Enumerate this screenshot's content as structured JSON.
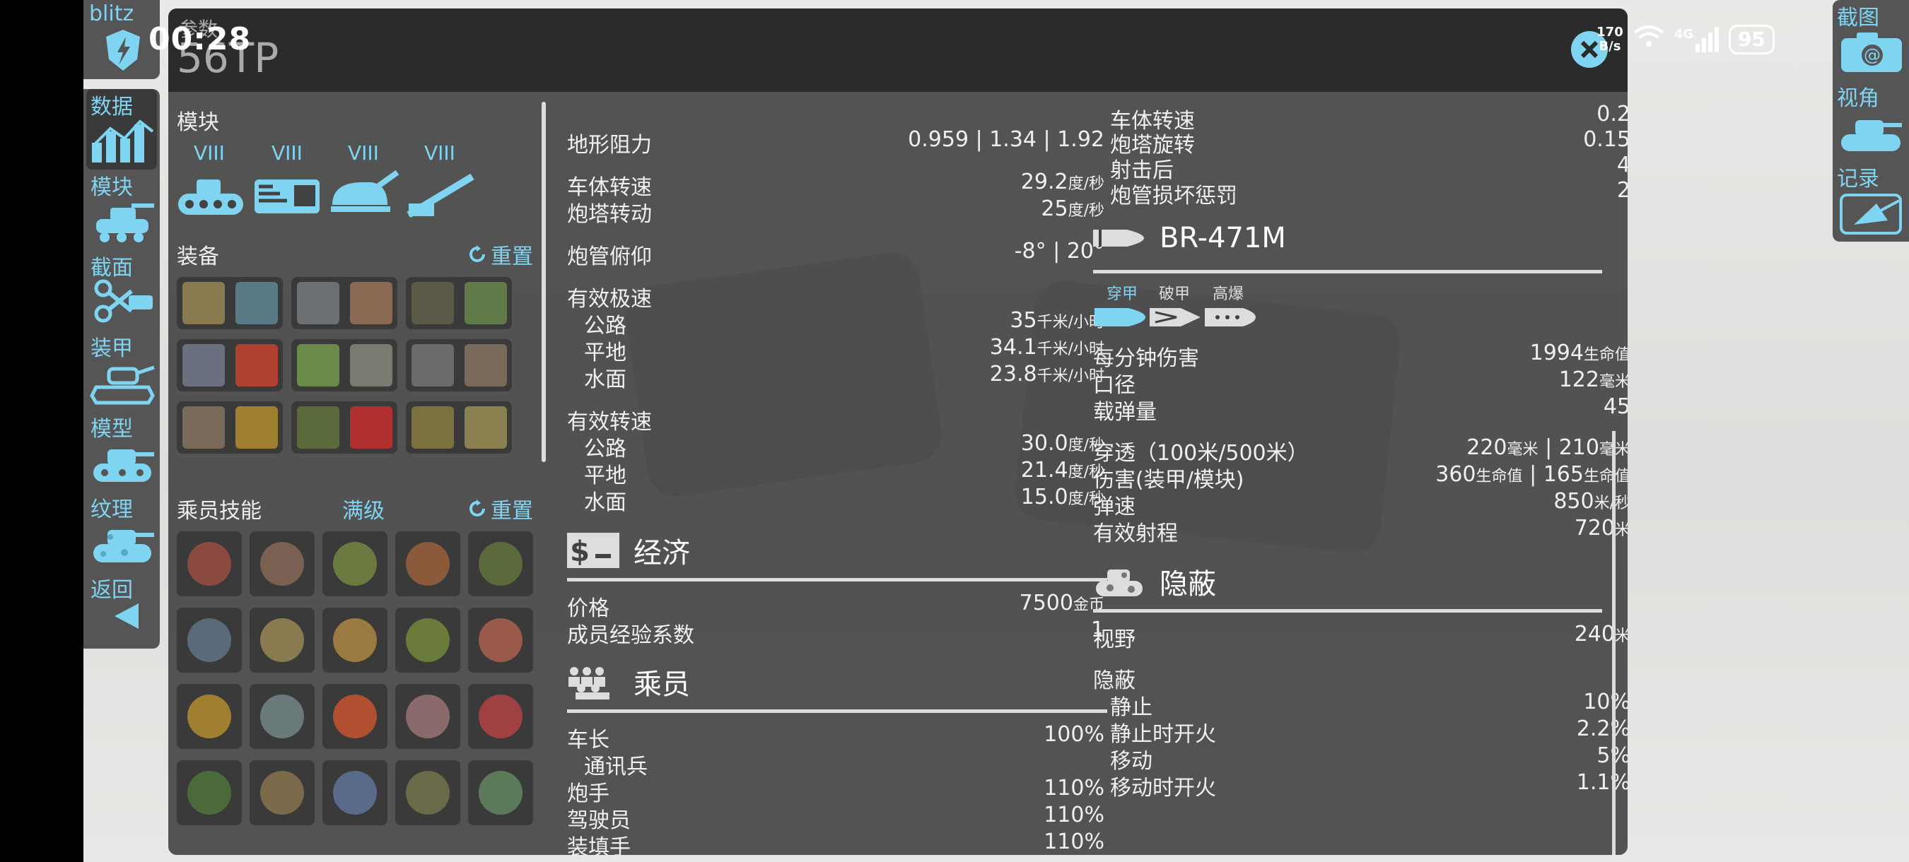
{
  "status": {
    "time": "00:28",
    "net_speed_top": "170",
    "net_speed_bottom": "B/s",
    "signal": "4G",
    "battery": "95"
  },
  "left_nav": {
    "brand": "blitz",
    "items": [
      {
        "label": "数据"
      },
      {
        "label": "模块"
      },
      {
        "label": "截面"
      },
      {
        "label": "装甲"
      },
      {
        "label": "模型"
      },
      {
        "label": "纹理"
      },
      {
        "label": "返回"
      }
    ]
  },
  "right_nav": {
    "items": [
      {
        "label": "截图"
      },
      {
        "label": "视角"
      },
      {
        "label": "记录"
      }
    ]
  },
  "header": {
    "small": "参数",
    "title": "56TP"
  },
  "modules": {
    "title": "模块",
    "tiers": [
      "VIII",
      "VIII",
      "VIII",
      "VIII"
    ]
  },
  "equipment": {
    "title": "装备",
    "reset": "重置"
  },
  "crew_skills": {
    "title": "乘员技能",
    "level": "满级",
    "reset": "重置"
  },
  "mobility": {
    "terrain_label": "地形阻力",
    "terrain_value": "0.959 | 1.34 | 1.92",
    "hull_trav_label": "车体转速",
    "hull_trav_value": "29.2",
    "hull_trav_unit": "度/秒",
    "turret_trav_label": "炮塔转动",
    "turret_trav_value": "25",
    "turret_trav_unit": "度/秒",
    "gun_elev_label": "炮管俯仰",
    "gun_elev_value": "-8° | 20°",
    "max_speed_label": "有效极速",
    "road_label": "公路",
    "road_speed": "35",
    "speed_unit": "千米/小时",
    "flat_label": "平地",
    "flat_speed": "34.1",
    "water_label": "水面",
    "water_speed": "23.8",
    "eff_trav_label": "有效转速",
    "road_trav": "30.0",
    "flat_trav": "21.4",
    "water_trav": "15.0",
    "trav_unit": "度/秒"
  },
  "economy": {
    "title": "经济",
    "price_label": "价格",
    "price_value": "7500",
    "price_unit": "金币",
    "xp_label": "成员经验系数",
    "xp_value": "1"
  },
  "crew": {
    "title": "乘员",
    "commander": "车长",
    "commander_val": "100%",
    "radio": "通讯兵",
    "gunner": "炮手",
    "gunner_val": "110%",
    "driver": "驾驶员",
    "driver_val": "110%",
    "loader": "装填手",
    "loader_val": "110%"
  },
  "dispersion": {
    "hull_label": "车体转速",
    "hull_val": "0.2",
    "turret_label": "炮塔旋转",
    "turret_val": "0.15",
    "after_shot_label": "射击后",
    "after_shot_val": "4",
    "damaged_label": "炮管损坏惩罚",
    "damaged_val": "2"
  },
  "gun": {
    "name": "BR-471M",
    "ammo_tabs": [
      "穿甲",
      "破甲",
      "高爆"
    ],
    "dpm_label": "每分钟伤害",
    "dpm_val": "1994",
    "hp_unit": "生命值",
    "caliber_label": "口径",
    "caliber_val": "122",
    "mm_unit": "毫米",
    "ammo_label": "载弹量",
    "ammo_val": "45",
    "pen_label": "穿透（100米/500米）",
    "pen_val1": "220",
    "pen_val2": "210",
    "dmg_label": "伤害(装甲/模块)",
    "dmg_val1": "360",
    "dmg_val2": "165",
    "vel_label": "弹速",
    "vel_val": "850",
    "vel_unit": "米/秒",
    "range_label": "有效射程",
    "range_val": "720",
    "m_unit": "米"
  },
  "camo": {
    "title": "隐蔽",
    "view_label": "视野",
    "view_val": "240",
    "view_unit": "米",
    "camo_label": "隐蔽",
    "still": "静止",
    "still_val": "10%",
    "still_fire": "静止时开火",
    "still_fire_val": "2.2%",
    "moving": "移动",
    "moving_val": "5%",
    "moving_fire": "移动时开火",
    "moving_fire_val": "1.1%"
  },
  "colors": {
    "accent": "#7fd4f2",
    "panel": "#424242",
    "header": "#2b2b2b"
  }
}
